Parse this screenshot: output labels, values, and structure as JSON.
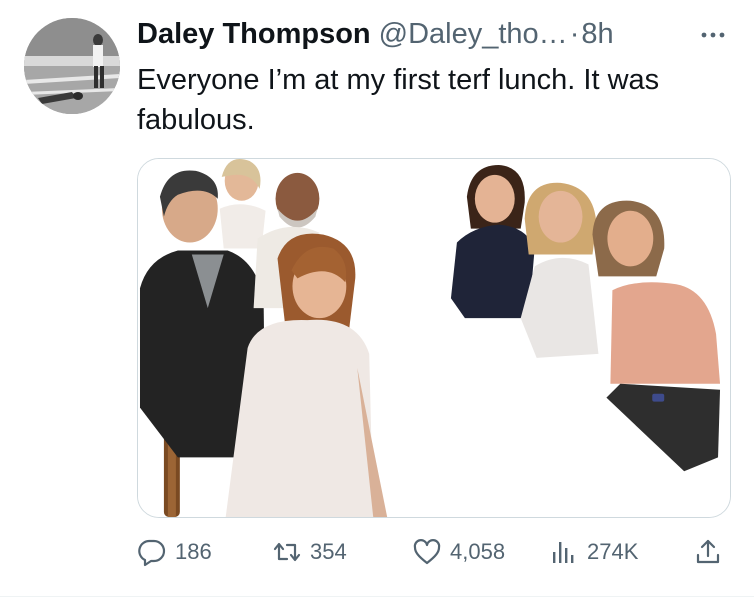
{
  "tweet": {
    "author": {
      "display_name": "Daley Thompson",
      "handle": "@Daley_tho…",
      "separator": "·",
      "time": "8h"
    },
    "text": "Everyone I’m at my first terf lunch. It was fabulous.",
    "media": {
      "kind": "photo"
    },
    "actions": {
      "replies": "186",
      "retweets": "354",
      "likes": "4,058",
      "views": "274K"
    },
    "icons": {
      "more": "more-horizontal-icon",
      "reply": "reply-bubble-icon",
      "retweet": "retweet-icon",
      "like": "heart-icon",
      "views": "views-bar-chart-icon",
      "share": "share-upload-icon"
    },
    "colors": {
      "text_primary": "#0f1419",
      "text_secondary": "#536471",
      "border": "#cfd9de"
    }
  }
}
